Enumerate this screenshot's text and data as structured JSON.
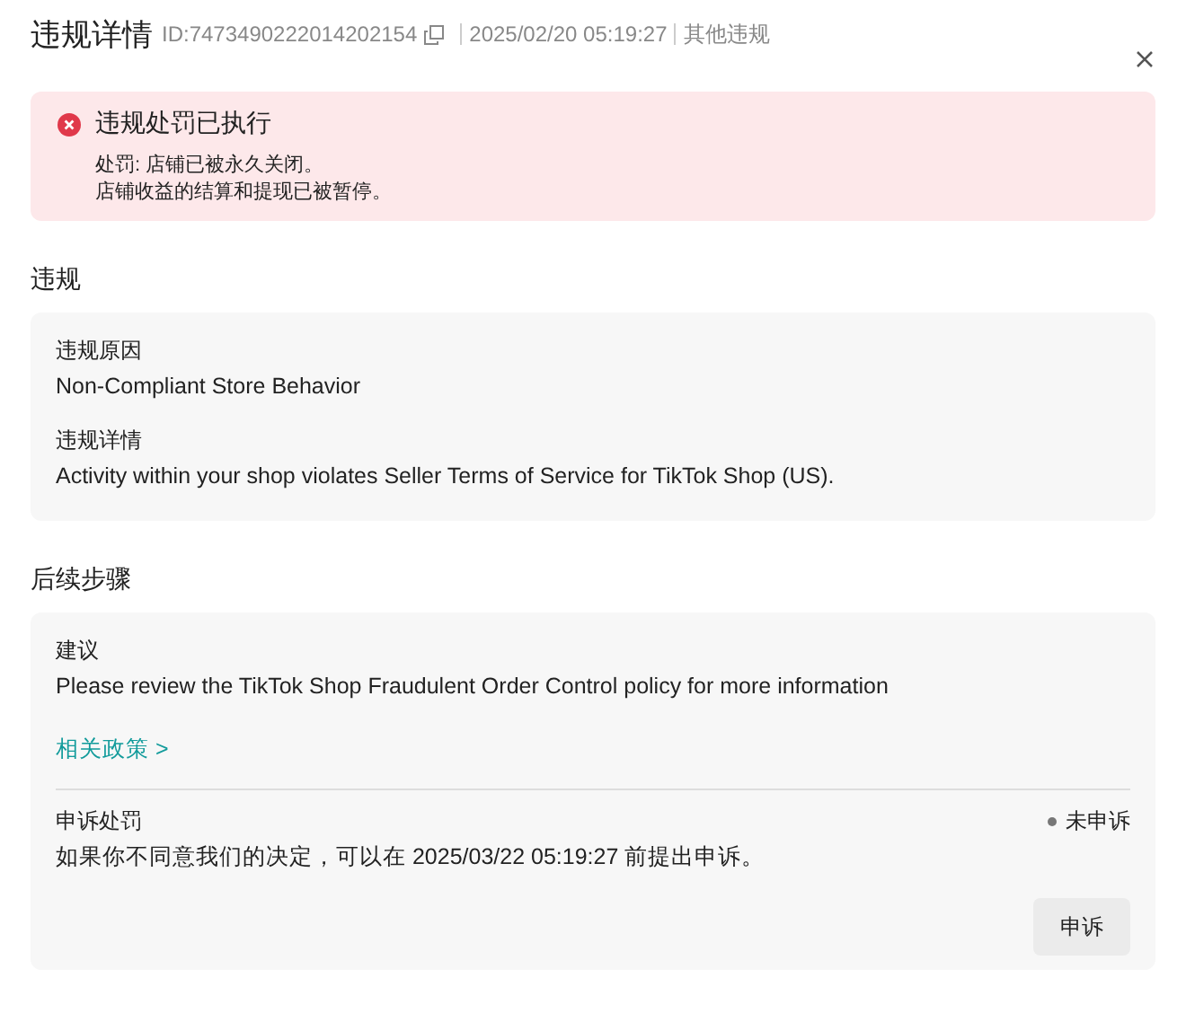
{
  "header": {
    "title": "违规详情",
    "id": "ID:7473490222014202154",
    "date": "2025/02/20 05:19:27",
    "category": "其他违规"
  },
  "alert": {
    "title": "违规处罚已执行",
    "lines": [
      "处罚: 店铺已被永久关闭。",
      "店铺收益的结算和提现已被暂停。"
    ]
  },
  "violation": {
    "heading": "违规",
    "fields": [
      {
        "label": "违规原因",
        "value": "Non-Compliant Store Behavior"
      },
      {
        "label": "违规详情",
        "value": "Activity within your shop violates Seller Terms of Service for TikTok Shop (US)."
      }
    ]
  },
  "next_steps": {
    "heading": "后续步骤",
    "suggestion_label": "建议",
    "suggestion": "Please review the TikTok Shop Fraudulent Order Control policy for more information",
    "policy_link": "相关政策 >",
    "appeal": {
      "label": "申诉处罚",
      "status": "未申诉",
      "text": "如果你不同意我们的决定，可以在 2025/03/22 05:19:27 前提出申诉。",
      "button": "申诉"
    }
  }
}
